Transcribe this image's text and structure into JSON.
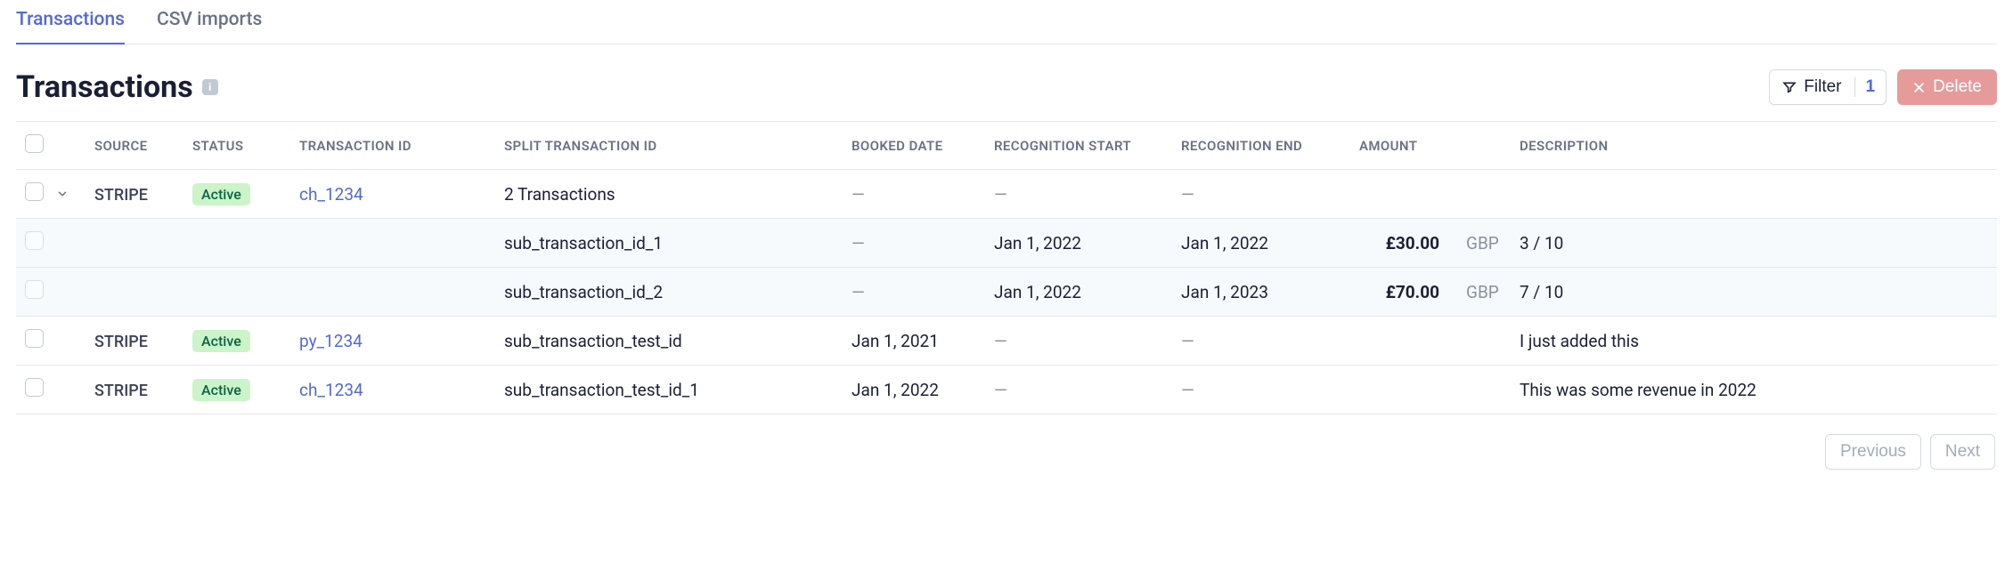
{
  "tabs": [
    {
      "label": "Transactions",
      "active": true
    },
    {
      "label": "CSV imports",
      "active": false
    }
  ],
  "header": {
    "title": "Transactions",
    "filter_label": "Filter",
    "filter_count": "1",
    "delete_label": "Delete"
  },
  "columns": {
    "source": "SOURCE",
    "status": "STATUS",
    "txid": "TRANSACTION ID",
    "split": "SPLIT TRANSACTION ID",
    "booked": "BOOKED DATE",
    "recstart": "RECOGNITION START",
    "recend": "RECOGNITION END",
    "amount": "AMOUNT",
    "description": "DESCRIPTION"
  },
  "rows": [
    {
      "type": "parent",
      "expanded": true,
      "source": "STRIPE",
      "status": "Active",
      "txid": "ch_1234",
      "split": "2 Transactions",
      "booked": "—",
      "recstart": "—",
      "recend": "—",
      "amount": "",
      "currency": "",
      "description": ""
    },
    {
      "type": "sub",
      "source": "",
      "status": "",
      "txid": "",
      "split": "sub_transaction_id_1",
      "booked": "—",
      "recstart": "Jan 1, 2022",
      "recend": "Jan 1, 2022",
      "amount": "£30.00",
      "currency": "GBP",
      "description": "3 / 10"
    },
    {
      "type": "sub",
      "source": "",
      "status": "",
      "txid": "",
      "split": "sub_transaction_id_2",
      "booked": "—",
      "recstart": "Jan 1, 2022",
      "recend": "Jan 1, 2023",
      "amount": "£70.00",
      "currency": "GBP",
      "description": "7 / 10"
    },
    {
      "type": "row",
      "source": "STRIPE",
      "status": "Active",
      "txid": "py_1234",
      "split": "sub_transaction_test_id",
      "booked": "Jan 1, 2021",
      "recstart": "—",
      "recend": "—",
      "amount": "",
      "currency": "",
      "description": "I just added this"
    },
    {
      "type": "row",
      "source": "STRIPE",
      "status": "Active",
      "txid": "ch_1234",
      "split": "sub_transaction_test_id_1",
      "booked": "Jan 1, 2022",
      "recstart": "—",
      "recend": "—",
      "amount": "",
      "currency": "",
      "description": "This was some revenue in 2022"
    }
  ],
  "pager": {
    "prev": "Previous",
    "next": "Next"
  }
}
